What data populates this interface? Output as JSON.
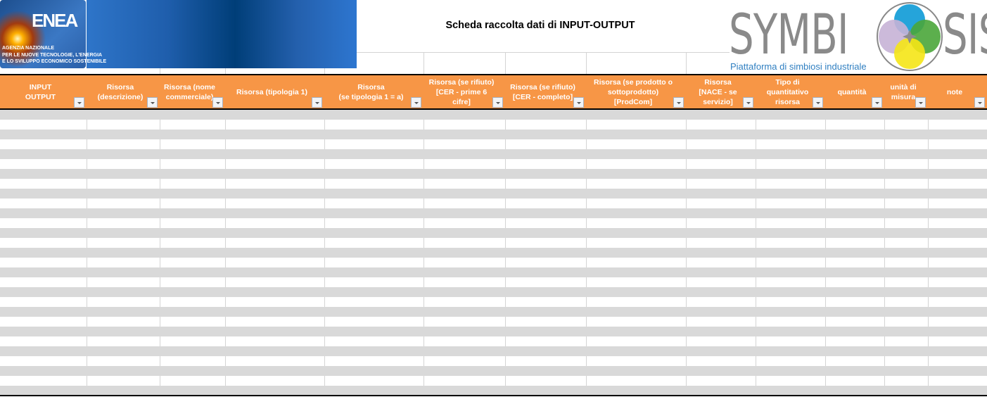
{
  "header": {
    "title": "Scheda raccolta dati di INPUT-OUTPUT",
    "enea_logo": {
      "text": "ENEA",
      "subtitle": [
        "AGENZIA NAZIONALE",
        "PER LE NUOVE TECNOLOGIE, L'ENERGIA",
        "E LO SVILUPPO ECONOMICO SOSTENIBILE"
      ]
    },
    "symbiosis_logo": {
      "text_left": "SYMBI",
      "text_right": "SIS",
      "tagline": "Piattaforma di simbiosi industriale"
    }
  },
  "columns": [
    {
      "label": "INPUT\nOUTPUT"
    },
    {
      "label": "Risorsa\n(descrizione)"
    },
    {
      "label": "Risorsa (nome\ncommerciale)"
    },
    {
      "label": "Risorsa (tipologia 1)"
    },
    {
      "label": "Risorsa\n(se tipologia 1 = a)"
    },
    {
      "label": "Risorsa (se rifiuto)\n[CER  -  prime 6\ncifre]"
    },
    {
      "label": "Risorsa (se rifiuto)\n[CER  -  completo]"
    },
    {
      "label": "Risorsa (se prodotto o\nsottoprodotto)\n[ProdCom]"
    },
    {
      "label": "Risorsa\n[NACE -  se\nservizio]"
    },
    {
      "label": "Tipo di\nquantitativo\nrisorsa"
    },
    {
      "label": "quantità"
    },
    {
      "label": "unità di\nmisura"
    },
    {
      "label": "note"
    }
  ],
  "colors": {
    "header_bg": "#f79646",
    "stripe": "#d9d9d9",
    "filter_icon": "dropdown-arrow-icon"
  }
}
